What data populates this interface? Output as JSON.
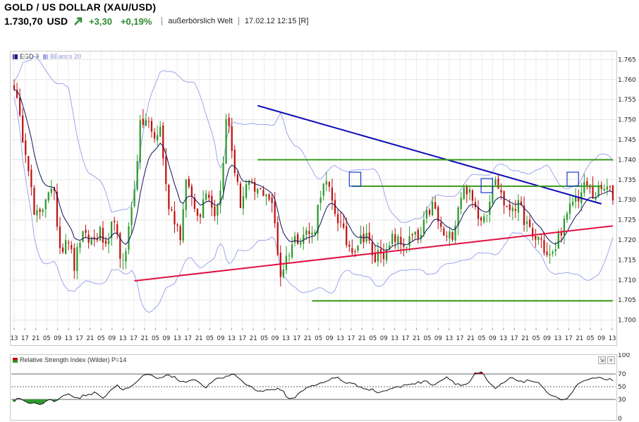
{
  "header": {
    "title": "GOLD / US DOLLAR (XAU/USD)",
    "price": "1.730,70",
    "currency": "USD",
    "change": "+3,30",
    "change_pct": "+0,19%",
    "venue": "außerbörslich Welt",
    "timestamp": "17.02.12 12:15 [R]"
  },
  "colors": {
    "up": "#2a9a2a",
    "down": "#c01010",
    "accent": "#2e8b2e"
  },
  "icons": {
    "trend": "arrow-up-right-icon",
    "compress": "compress-icon",
    "close": "close-icon"
  },
  "chart_data": [
    {
      "type": "candlestick",
      "title": "",
      "legend": [
        {
          "name": "EGD 9",
          "color": "#1a1a8a"
        },
        {
          "name": "BBands 20",
          "color": "#9ea6ee"
        }
      ],
      "y_ticks": [
        "1.765",
        "1.760",
        "1.755",
        "1.750",
        "1.745",
        "1.740",
        "1.735",
        "1.730",
        "1.725",
        "1.720",
        "1.715",
        "1.710",
        "1.705",
        "1.700"
      ],
      "ylim": [
        1.698,
        1.767
      ],
      "x_ticks": [
        "13",
        "17",
        "21",
        "05",
        "09",
        "13",
        "17",
        "21",
        "05",
        "09",
        "13",
        "17",
        "21",
        "05",
        "09",
        "13",
        "17",
        "21",
        "05",
        "09",
        "13",
        "17",
        "21",
        "05",
        "09",
        "13",
        "17",
        "21",
        "05",
        "09",
        "13",
        "17",
        "21",
        "05",
        "09",
        "13",
        "17",
        "21",
        "05",
        "09",
        "13",
        "17",
        "21",
        "05",
        "09",
        "13",
        "17",
        "21",
        "05",
        "09",
        "13",
        "17",
        "21",
        "05",
        "09",
        "13"
      ],
      "n_candles": 210,
      "close_path": [
        1.759,
        1.748,
        1.741,
        1.726,
        1.726,
        1.733,
        1.731,
        1.717,
        1.722,
        1.713,
        1.721,
        1.72,
        1.72,
        1.722,
        1.716,
        1.727,
        1.713,
        1.72,
        1.732,
        1.749,
        1.75,
        1.745,
        1.748,
        1.73,
        1.726,
        1.721,
        1.736,
        1.728,
        1.727,
        1.734,
        1.726,
        1.732,
        1.752,
        1.739,
        1.729,
        1.734,
        1.732,
        1.732,
        1.732,
        1.727,
        1.711,
        1.716,
        1.72,
        1.721,
        1.722,
        1.721,
        1.732,
        1.734,
        1.728,
        1.724,
        1.719,
        1.718,
        1.72,
        1.722,
        1.714,
        1.718,
        1.716,
        1.721,
        1.719,
        1.719,
        1.721,
        1.72,
        1.726,
        1.729,
        1.723,
        1.72,
        1.722,
        1.731,
        1.733,
        1.729,
        1.726,
        1.727,
        1.735,
        1.733,
        1.727,
        1.729,
        1.728,
        1.724,
        1.72,
        1.721,
        1.716,
        1.716,
        1.722,
        1.725,
        1.73,
        1.731,
        1.734,
        1.731,
        1.732,
        1.733,
        1.731
      ],
      "lines": [
        {
          "name": "resistance-trendline",
          "color": "#0a0ab4",
          "from": [
            85,
            1.7535
          ],
          "to": [
            205,
            1.729
          ]
        },
        {
          "name": "support-trendline",
          "color": "#e01040",
          "from": [
            42,
            1.7098
          ],
          "to": [
            210,
            1.7235
          ]
        },
        {
          "name": "level-1740",
          "color": "#3a9a1a",
          "from": [
            85,
            1.74
          ],
          "to": [
            210,
            1.74
          ]
        },
        {
          "name": "level-1733",
          "color": "#3a9a1a",
          "from": [
            118,
            1.7334
          ],
          "to": [
            205,
            1.7334
          ]
        },
        {
          "name": "level-1705",
          "color": "#3a9a1a",
          "from": [
            104,
            1.7048
          ],
          "to": [
            210,
            1.7048
          ]
        }
      ],
      "boxes": [
        {
          "name": "marker-box-1",
          "color": "#1a3acc",
          "x": [
            117,
            121
          ],
          "y": [
            1.7334,
            1.7369
          ]
        },
        {
          "name": "marker-box-2",
          "color": "#1a3acc",
          "x": [
            163,
            167
          ],
          "y": [
            1.7318,
            1.7353
          ]
        },
        {
          "name": "marker-box-3",
          "color": "#1a3acc",
          "x": [
            193,
            197
          ],
          "y": [
            1.7334,
            1.7369
          ]
        }
      ]
    },
    {
      "type": "line",
      "title": "Relative Strength Index (Wilder) P=14",
      "y_ticks": [
        "100",
        "70",
        "50",
        "30",
        "0"
      ],
      "ylim": [
        0,
        100
      ],
      "levels": [
        70,
        50,
        30
      ],
      "rsi_path": [
        28,
        33,
        24,
        25,
        23,
        28,
        27,
        35,
        40,
        30,
        36,
        38,
        41,
        32,
        45,
        52,
        45,
        50,
        58,
        71,
        67,
        64,
        68,
        66,
        60,
        57,
        64,
        54,
        49,
        60,
        63,
        67,
        70,
        60,
        52,
        46,
        43,
        45,
        47,
        43,
        30,
        35,
        45,
        52,
        53,
        56,
        62,
        65,
        57,
        55,
        51,
        48,
        45,
        41,
        44,
        48,
        49,
        54,
        55,
        57,
        58,
        53,
        60,
        66,
        56,
        52,
        55,
        70,
        72,
        55,
        47,
        55,
        63,
        61,
        58,
        60,
        57,
        45,
        38,
        33,
        28,
        40,
        55,
        60,
        62,
        63,
        62,
        61
      ]
    }
  ]
}
